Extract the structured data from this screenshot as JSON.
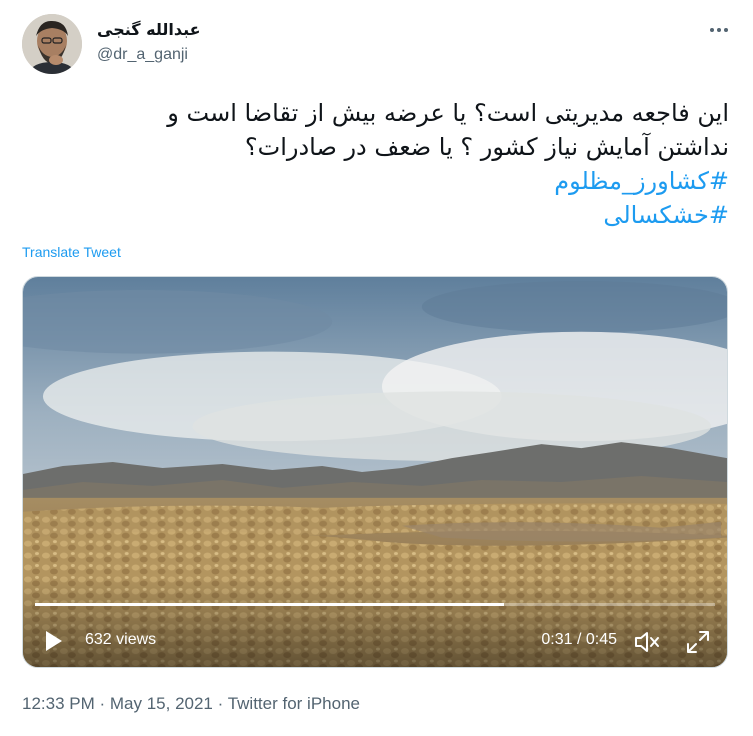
{
  "user": {
    "display_name": "عبدالله گنجی",
    "handle": "@dr_a_ganji"
  },
  "tweet": {
    "lines": [
      "این فاجعه مدیریتی است؟ یا عرضه بیش از تقاضا است و",
      "نداشتن آمایش نیاز کشور ؟ یا ضعف در صادرات؟"
    ],
    "hashtags": [
      "#کشاورز_مظلوم",
      "#خشکسالی"
    ],
    "translate_label": "Translate Tweet"
  },
  "video": {
    "views": "632 views",
    "time": "0:31 / 0:45",
    "progress": 0.69
  },
  "footer": {
    "time": "12:33 PM",
    "sep1": " · ",
    "date": "May 15, 2021",
    "sep2": " · ",
    "source": "Twitter for iPhone"
  },
  "colors": {
    "link": "#1d9bf0",
    "secondary_text": "#536471"
  },
  "icons": [
    "more-icon",
    "play-icon",
    "volume-icon",
    "fullscreen-icon"
  ]
}
